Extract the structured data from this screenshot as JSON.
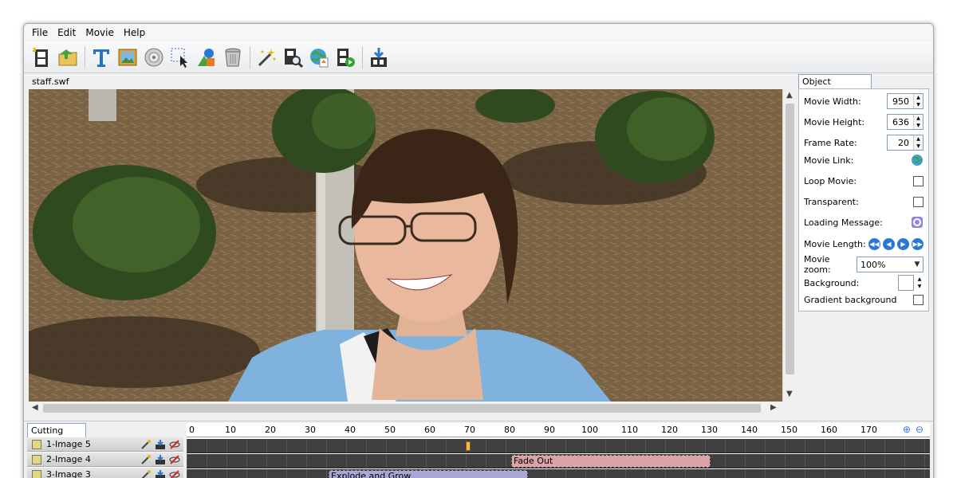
{
  "menu": [
    "File",
    "Edit",
    "Movie",
    "Help"
  ],
  "toolbar": {
    "tools": [
      "new-movie-icon",
      "open-file-icon",
      "text-tool-icon",
      "image-tool-icon",
      "sound-tool-icon",
      "select-tool-icon",
      "shapes-tool-icon",
      "trash-icon",
      "magic-wand-icon",
      "preview-icon",
      "publish-web-icon",
      "play-movie-icon",
      "export-icon"
    ]
  },
  "file": {
    "name": "staff.swf"
  },
  "properties": {
    "tab": "Object Properties",
    "movie_width_label": "Movie Width:",
    "movie_width": "950",
    "movie_height_label": "Movie Height:",
    "movie_height": "636",
    "frame_rate_label": "Frame Rate:",
    "frame_rate": "20",
    "movie_link_label": "Movie Link:",
    "loop_label": "Loop Movie:",
    "transparent_label": "Transparent:",
    "loading_label": "Loading Message:",
    "length_label": "Movie Length:",
    "zoom_label": "Movie zoom:",
    "zoom_value": "100%",
    "background_label": "Background:",
    "gradient_label": "Gradient background"
  },
  "cutting_room": {
    "tab": "Cutting Room",
    "layers": [
      {
        "name": "1-Image 5"
      },
      {
        "name": "2-Image 4"
      },
      {
        "name": "3-Image 3"
      }
    ],
    "ticks": [
      "0",
      "10",
      "20",
      "30",
      "40",
      "50",
      "60",
      "70",
      "80",
      "90",
      "100",
      "110",
      "120",
      "130",
      "140",
      "150",
      "160",
      "170"
    ],
    "effects": [
      {
        "label": "Fade Out",
        "color": "#d9a3a8"
      },
      {
        "label": "Explode and Grow",
        "color": "#a9a7d6"
      }
    ]
  }
}
